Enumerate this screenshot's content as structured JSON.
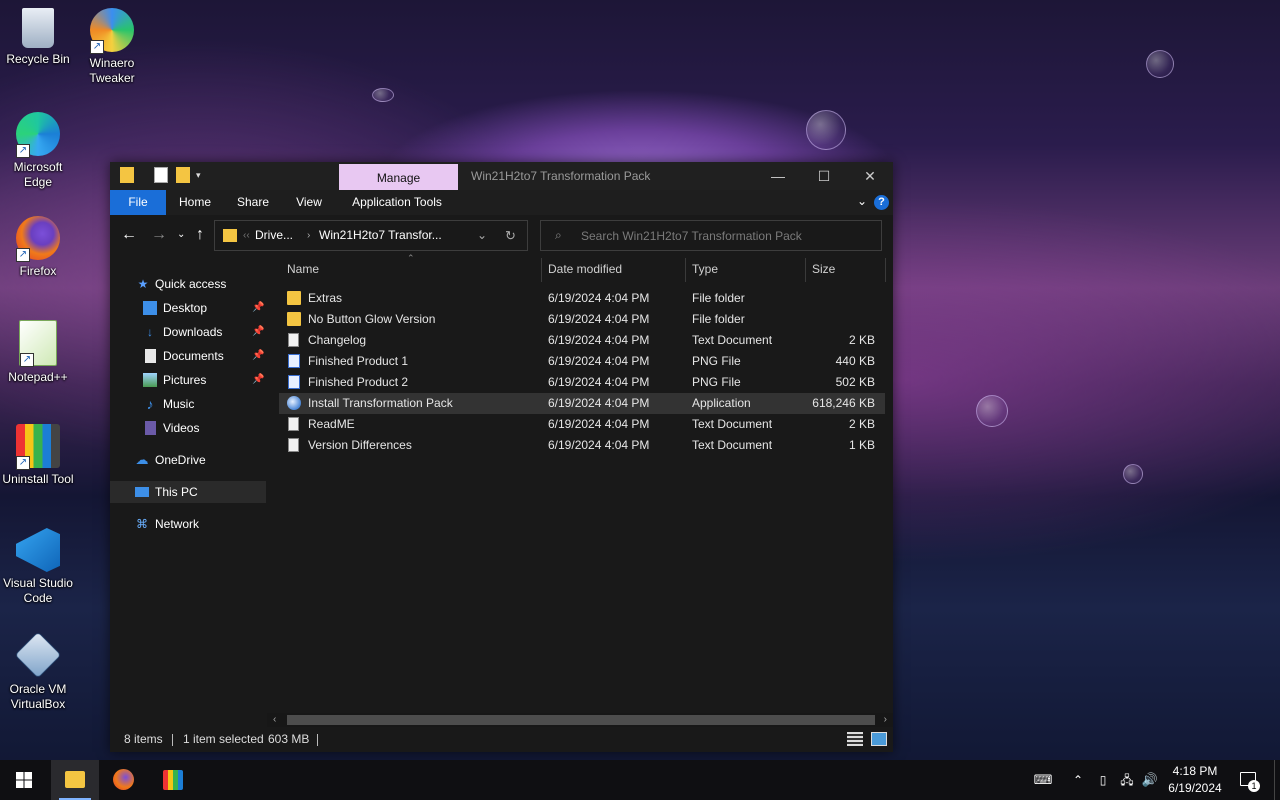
{
  "desktop": {
    "icons": [
      {
        "label": "Recycle Bin"
      },
      {
        "label": "Winaero Tweaker"
      },
      {
        "label": "Microsoft Edge"
      },
      {
        "label": "Firefox"
      },
      {
        "label": "Notepad++"
      },
      {
        "label": "Uninstall Tool"
      },
      {
        "label": "Visual Studio Code"
      },
      {
        "label": "Oracle VM VirtualBox"
      }
    ]
  },
  "window": {
    "title": "Win21H2to7 Transformation Pack",
    "context_tab": "Manage",
    "ribbon_tabs": [
      "File",
      "Home",
      "Share",
      "View",
      "Application Tools"
    ],
    "help_label": "?",
    "address": {
      "crumbs": [
        "Drive...",
        "Win21H2to7 Transfor..."
      ]
    },
    "search": {
      "placeholder": "Search Win21H2to7 Transformation Pack"
    },
    "nav": {
      "items": [
        {
          "label": "Quick access"
        },
        {
          "label": "Desktop"
        },
        {
          "label": "Downloads"
        },
        {
          "label": "Documents"
        },
        {
          "label": "Pictures"
        },
        {
          "label": "Music"
        },
        {
          "label": "Videos"
        },
        {
          "label": "OneDrive"
        },
        {
          "label": "This PC"
        },
        {
          "label": "Network"
        }
      ]
    },
    "columns": [
      "Name",
      "Date modified",
      "Type",
      "Size"
    ],
    "files": [
      {
        "name": "Extras",
        "date": "6/19/2024 4:04 PM",
        "type": "File folder",
        "size": ""
      },
      {
        "name": "No Button Glow Version",
        "date": "6/19/2024 4:04 PM",
        "type": "File folder",
        "size": ""
      },
      {
        "name": "Changelog",
        "date": "6/19/2024 4:04 PM",
        "type": "Text Document",
        "size": "2 KB"
      },
      {
        "name": "Finished Product 1",
        "date": "6/19/2024 4:04 PM",
        "type": "PNG File",
        "size": "440 KB"
      },
      {
        "name": "Finished Product 2",
        "date": "6/19/2024 4:04 PM",
        "type": "PNG File",
        "size": "502 KB"
      },
      {
        "name": "Install Transformation Pack",
        "date": "6/19/2024 4:04 PM",
        "type": "Application",
        "size": "618,246 KB"
      },
      {
        "name": "ReadME",
        "date": "6/19/2024 4:04 PM",
        "type": "Text Document",
        "size": "2 KB"
      },
      {
        "name": "Version Differences",
        "date": "6/19/2024 4:04 PM",
        "type": "Text Document",
        "size": "1 KB"
      }
    ],
    "status": {
      "items": "8 items",
      "selected": "1 item selected",
      "size": "603 MB"
    }
  },
  "taskbar": {
    "time": "4:18 PM",
    "date": "6/19/2024",
    "notification_count": "1"
  }
}
